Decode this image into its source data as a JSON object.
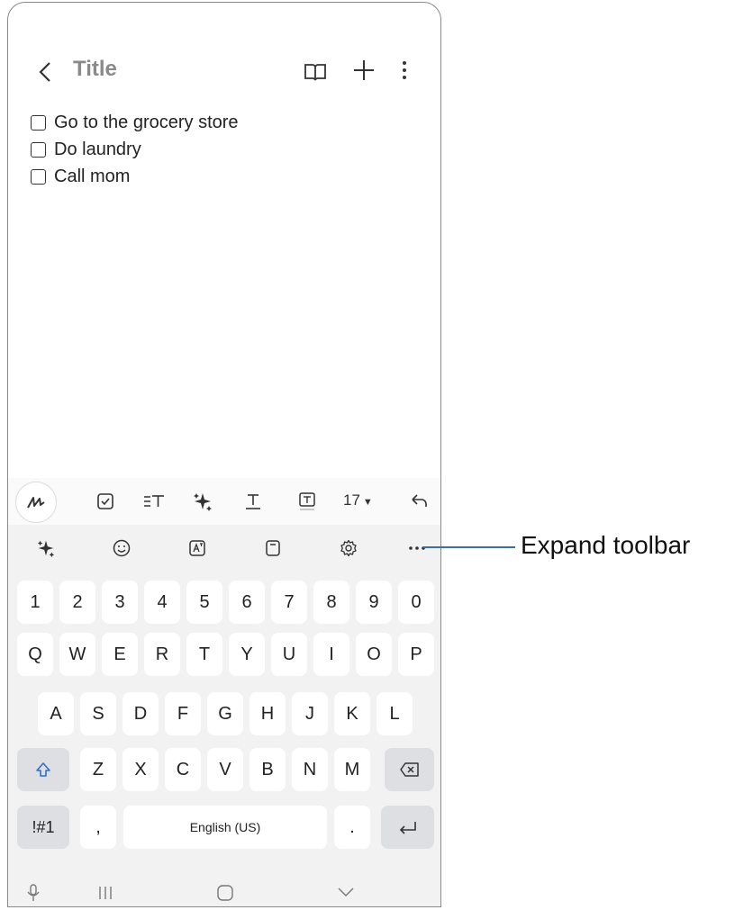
{
  "header": {
    "title": "Title"
  },
  "note": {
    "items": [
      {
        "label": "Go to the grocery store",
        "checked": false
      },
      {
        "label": "Do laundry",
        "checked": false
      },
      {
        "label": "Call mom",
        "checked": false
      }
    ]
  },
  "format_toolbar": {
    "icons": [
      "handwriting-icon",
      "checkbox-list-icon",
      "text-align-icon",
      "ai-assist-icon",
      "text-style-icon",
      "text-box-icon",
      "font-size-dropdown",
      "undo-icon"
    ],
    "font_size": "17"
  },
  "keyboard_toolbar": {
    "icons": [
      "ai-sparkle-icon",
      "emoji-icon",
      "translate-icon",
      "clipboard-icon",
      "settings-icon",
      "expand-toolbar-icon"
    ]
  },
  "keyboard": {
    "number_row": [
      "1",
      "2",
      "3",
      "4",
      "5",
      "6",
      "7",
      "8",
      "9",
      "0"
    ],
    "row1": [
      "Q",
      "W",
      "E",
      "R",
      "T",
      "Y",
      "U",
      "I",
      "O",
      "P"
    ],
    "row2": [
      "A",
      "S",
      "D",
      "F",
      "G",
      "H",
      "J",
      "K",
      "L"
    ],
    "row3": [
      "Z",
      "X",
      "C",
      "V",
      "B",
      "N",
      "M"
    ],
    "symbols_key": "!#1",
    "comma_key": ",",
    "space_label": "English (US)",
    "period_key": "."
  },
  "callout": {
    "label": "Expand toolbar",
    "color": "#3a6ea5"
  }
}
